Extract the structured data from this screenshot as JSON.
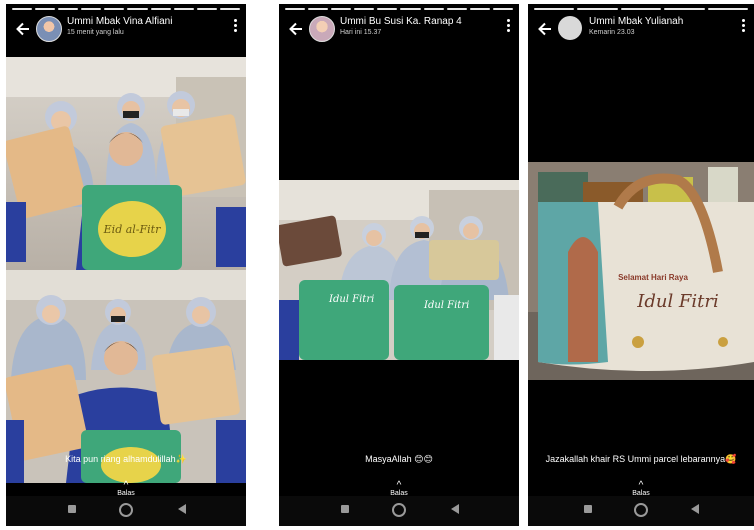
{
  "stories": [
    {
      "name": "Ummi Mbak Vina Alfiani",
      "time": "15 menit yang lalu",
      "caption": "Kita pun riang alhamdulillah✨",
      "reply_label": "Balas",
      "progress_total": 10,
      "progress_done": 10
    },
    {
      "name": "Ummi Bu Susi Ka. Ranap 4",
      "time": "Hari ini 15.37",
      "caption": "MasyaAllah 😊😊",
      "reply_label": "Balas",
      "progress_total": 10,
      "progress_done": 10
    },
    {
      "name": "Ummi Mbak Yulianah",
      "time": "Kemarin 23.03",
      "caption": "Jazakallah khair RS Ummi parcel lebarannya🥰",
      "reply_label": "Balas",
      "progress_total": 5,
      "progress_done": 5
    }
  ],
  "photo_texts": {
    "bag_eid_1": "Eid al-Fitr",
    "bag_title_2": "Idul Fitri",
    "bag_header_3": "Selamat Hari Raya",
    "bag_title_3": "Idul Fitri"
  },
  "colors": {
    "background": "#000000",
    "text": "#ffffff",
    "uniform_blue": "#2a3f9e",
    "hijab": "#a9b7cc",
    "bag_green": "#3fa77a"
  },
  "icons": {
    "back": "arrow-left-icon",
    "menu": "more-vertical-icon",
    "reply": "chevron-up-icon",
    "nav": [
      "recent-apps-icon",
      "home-icon",
      "back-triangle-icon"
    ]
  }
}
